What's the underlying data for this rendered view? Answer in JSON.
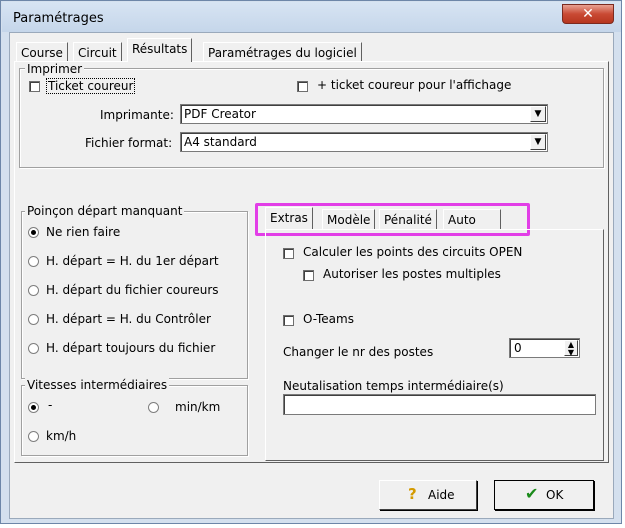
{
  "window": {
    "title": "Paramétrages",
    "close_glyph": "✕"
  },
  "tabs": [
    "Course",
    "Circuit",
    "Résultats",
    "Paramétrages du logiciel"
  ],
  "imprimer": {
    "legend": "Imprimer",
    "ticket_coureur": "Ticket coureur",
    "ticket_affichage": "+ ticket coureur pour l'affichage",
    "imprimante_label": "Imprimante:",
    "imprimante_value": "PDF Creator",
    "fichier_format_label": "Fichier format:",
    "fichier_format_value": "A4 standard"
  },
  "poincon": {
    "legend": "Poinçon départ manquant",
    "options": [
      "Ne rien faire",
      "H. départ = H. du 1er départ",
      "H. départ du fichier coureurs",
      "H. départ = H. du Contrôler",
      "H. départ toujours du fichier"
    ],
    "selected_index": 0
  },
  "vitesses": {
    "legend": "Vitesses intermédiaires",
    "option_dash": "-",
    "option_minkm": "min/km",
    "option_kmh": "km/h",
    "selected": "-"
  },
  "inner_tabs": [
    "Extras",
    "Modèle",
    "Pénalité",
    "Auto"
  ],
  "extras": {
    "calculer": "Calculer les points des circuits OPEN",
    "autoriser": "Autoriser les postes multiples",
    "oteams": "O-Teams",
    "changer_label": "Changer le nr des postes",
    "changer_value": "0",
    "neutralisation_label": "Neutalisation temps intermédiaire(s)",
    "neutralisation_value": ""
  },
  "buttons": {
    "aide": "Aide",
    "ok": "OK",
    "aide_icon": "?",
    "ok_icon": "✔"
  },
  "colors": {
    "highlight": "#e23ee7",
    "title_bg": "#c5d6ea",
    "close_red": "#c94a34"
  }
}
